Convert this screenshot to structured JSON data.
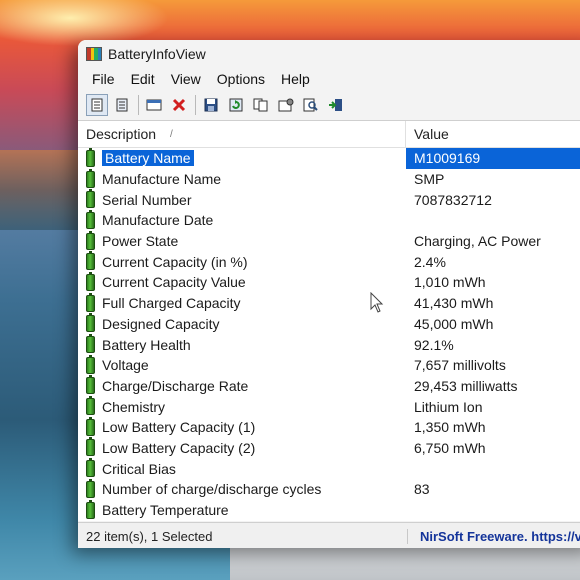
{
  "window": {
    "title": "BatteryInfoView"
  },
  "menu": [
    "File",
    "Edit",
    "View",
    "Options",
    "Help"
  ],
  "toolbar": {
    "icons": [
      "html-report-icon",
      "text-report-icon",
      "properties-icon",
      "delete-icon",
      "save-icon",
      "refresh-icon",
      "copy-icon",
      "options-icon",
      "find-icon",
      "exit-icon"
    ]
  },
  "columns": {
    "description": "Description",
    "value": "Value"
  },
  "rows": [
    {
      "label": "Battery Name",
      "value": "M1009169"
    },
    {
      "label": "Manufacture Name",
      "value": "SMP"
    },
    {
      "label": "Serial Number",
      "value": "7087832712"
    },
    {
      "label": "Manufacture Date",
      "value": ""
    },
    {
      "label": "Power State",
      "value": "Charging, AC Power"
    },
    {
      "label": "Current Capacity (in %)",
      "value": "2.4%"
    },
    {
      "label": "Current Capacity Value",
      "value": "1,010 mWh"
    },
    {
      "label": "Full Charged Capacity",
      "value": "41,430 mWh"
    },
    {
      "label": "Designed Capacity",
      "value": "45,000 mWh"
    },
    {
      "label": "Battery Health",
      "value": "92.1%"
    },
    {
      "label": "Voltage",
      "value": "7,657 millivolts"
    },
    {
      "label": "Charge/Discharge Rate",
      "value": "29,453 milliwatts"
    },
    {
      "label": "Chemistry",
      "value": "Lithium Ion"
    },
    {
      "label": "Low Battery Capacity (1)",
      "value": "1,350 mWh"
    },
    {
      "label": "Low Battery Capacity (2)",
      "value": "6,750 mWh"
    },
    {
      "label": "Critical Bias",
      "value": ""
    },
    {
      "label": "Number of charge/discharge cycles",
      "value": "83"
    },
    {
      "label": "Battery Temperature",
      "value": ""
    }
  ],
  "status": {
    "count": "22 item(s), 1 Selected",
    "link": "NirSoft Freeware. https://v"
  },
  "colors": {
    "selection": "#0a64d8",
    "link": "#14349a",
    "battery_icon": "#56c03a"
  }
}
